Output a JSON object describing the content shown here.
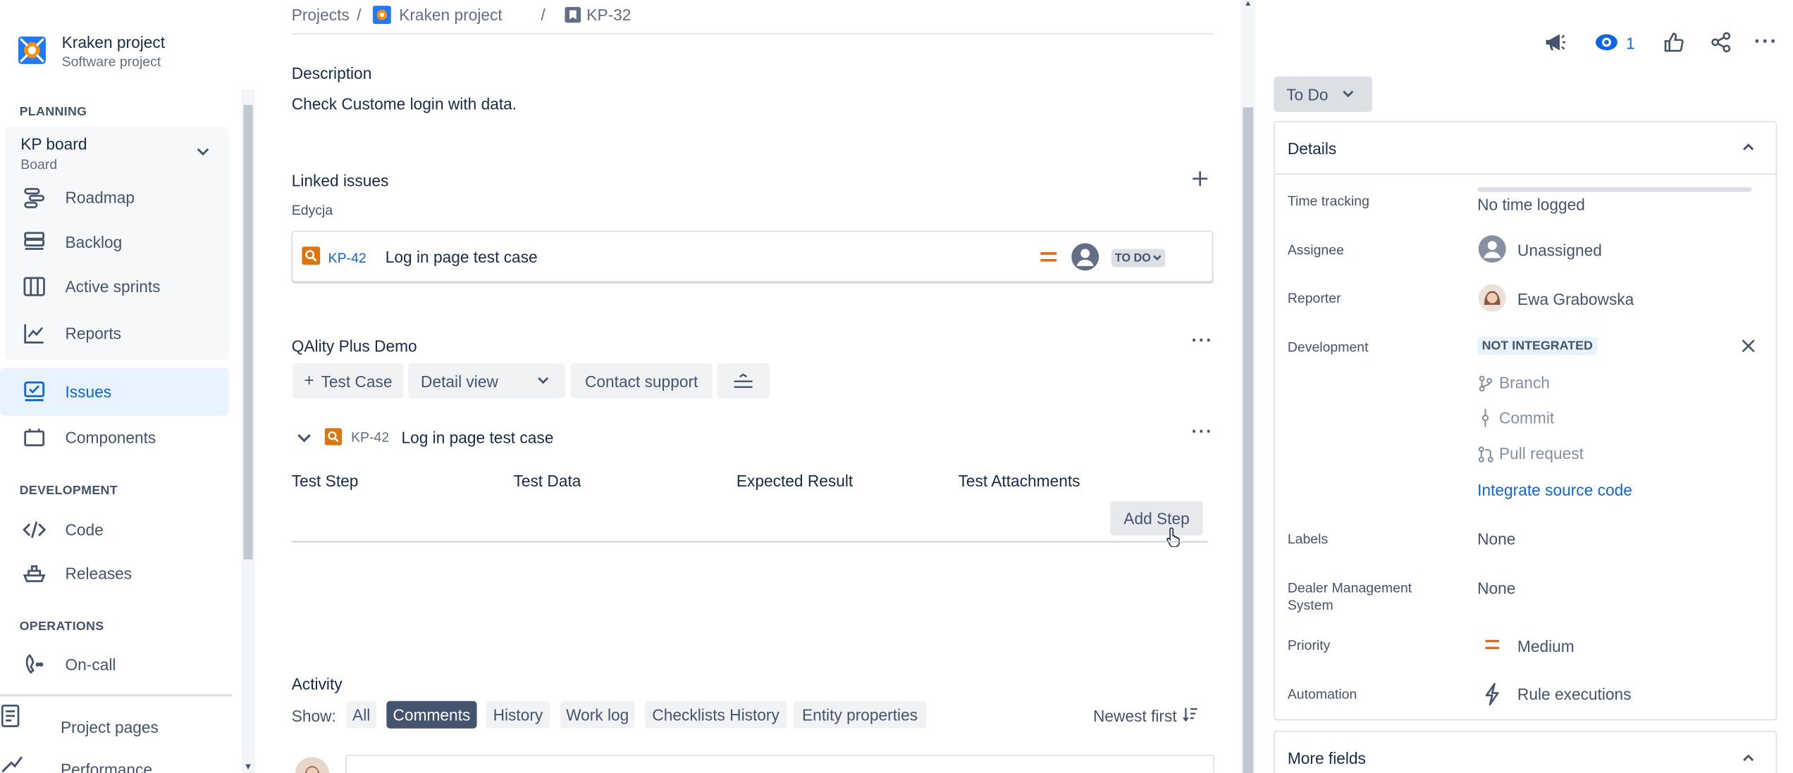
{
  "sidebar": {
    "project_name": "Kraken project",
    "project_type": "Software project",
    "planning_header": "PLANNING",
    "board_name": "KP board",
    "board_type": "Board",
    "items": [
      {
        "label": "Roadmap",
        "icon": "roadmap-icon"
      },
      {
        "label": "Backlog",
        "icon": "backlog-icon"
      },
      {
        "label": "Active sprints",
        "icon": "active-sprints-icon"
      },
      {
        "label": "Reports",
        "icon": "reports-icon"
      },
      {
        "label": "Issues",
        "icon": "issues-icon"
      },
      {
        "label": "Components",
        "icon": "components-icon"
      }
    ],
    "development_header": "DEVELOPMENT",
    "dev_items": [
      {
        "label": "Code",
        "icon": "code-icon"
      },
      {
        "label": "Releases",
        "icon": "releases-icon"
      }
    ],
    "operations_header": "OPERATIONS",
    "ops_items": [
      {
        "label": "On-call",
        "icon": "on-call-icon"
      }
    ],
    "bottom_items": [
      {
        "label": "Project pages",
        "icon": "project-pages-icon"
      },
      {
        "label": "Performance",
        "icon": "performance-icon"
      }
    ]
  },
  "breadcrumb": {
    "projects": "Projects",
    "sep": "/",
    "project": "Kraken project",
    "issue": "KP-32"
  },
  "description": {
    "title": "Description",
    "text": "Check Custome login with data."
  },
  "linked": {
    "title": "Linked issues",
    "relation": "Edycja",
    "issue_key": "KP-42",
    "issue_summary": "Log in page test case",
    "status": "TO DO"
  },
  "qality": {
    "title": "QAlity Plus Demo",
    "add_test_case": "Test Case",
    "view_select": "Detail view",
    "contact_support": "Contact support",
    "case_key": "KP-42",
    "case_summary": "Log in page test case",
    "columns": [
      "Test Step",
      "Test Data",
      "Expected Result",
      "Test Attachments"
    ],
    "add_step": "Add Step"
  },
  "activity": {
    "title": "Activity",
    "show_label": "Show:",
    "filters": [
      "All",
      "Comments",
      "History",
      "Work log",
      "Checklists History",
      "Entity properties"
    ],
    "active_filter": "Comments",
    "sort": "Newest first"
  },
  "topbar": {
    "watchers": "1"
  },
  "status_button": "To Do",
  "details": {
    "title": "Details",
    "time_tracking_label": "Time tracking",
    "time_tracking_value": "No time logged",
    "assignee_label": "Assignee",
    "assignee_value": "Unassigned",
    "reporter_label": "Reporter",
    "reporter_value": "Ewa Grabowska",
    "development_label": "Development",
    "development_badge": "NOT INTEGRATED",
    "dev_links": [
      "Branch",
      "Commit",
      "Pull request"
    ],
    "integrate": "Integrate source code",
    "labels_label": "Labels",
    "labels_value": "None",
    "dms_label": "Dealer Management System",
    "dms_value": "None",
    "priority_label": "Priority",
    "priority_value": "Medium",
    "automation_label": "Automation",
    "automation_value": "Rule executions"
  },
  "more_fields": "More fields",
  "colors": {
    "accent": "#0c66e4",
    "active_bg": "#e9f2ff",
    "priority": "#e56910",
    "issue_icon": "#e2740d",
    "comments_bg": "#44546f"
  }
}
